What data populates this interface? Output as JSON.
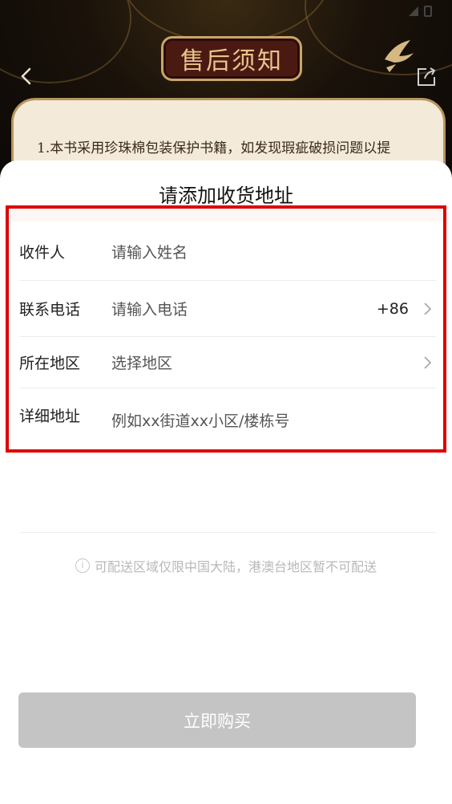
{
  "background": {
    "banner_text": "售后须知",
    "notice_text": "1.本书采用珍珠棉包装保护书籍，如发现瑕疵破损问题以提",
    "icons": {
      "back": "chevron-left-icon",
      "share": "share-icon"
    }
  },
  "sheet": {
    "title": "请添加收货地址",
    "fields": [
      {
        "label": "收件人",
        "placeholder": "请输入姓名"
      },
      {
        "label": "联系电话",
        "placeholder": "请输入电话",
        "prefix": "+86"
      },
      {
        "label": "所在地区",
        "placeholder": "选择地区"
      },
      {
        "label": "详细地址",
        "placeholder": "例如xx街道xx小区/楼栋号"
      }
    ],
    "tip": "可配送区域仅限中国大陆，港澳台地区暂不可配送",
    "buy_label": "立即购买"
  },
  "colors": {
    "highlight_border": "#e00000",
    "button_disabled": "#c4c4c4"
  }
}
